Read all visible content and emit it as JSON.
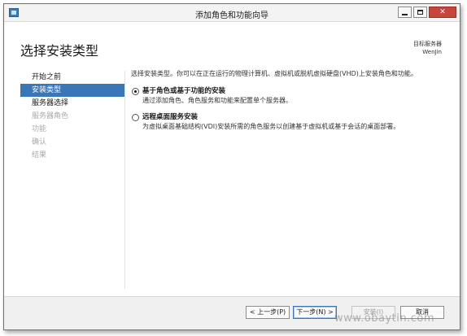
{
  "window": {
    "title": "添加角色和功能向导",
    "min_label": "",
    "max_label": "",
    "close_label": "✕"
  },
  "header": {
    "page_title": "选择安装类型",
    "destination_label": "目标服务器",
    "destination_server": "WenJin"
  },
  "nav": {
    "items": [
      {
        "label": "开始之前",
        "state": "normal"
      },
      {
        "label": "安装类型",
        "state": "selected"
      },
      {
        "label": "服务器选择",
        "state": "normal"
      },
      {
        "label": "服务器角色",
        "state": "disabled"
      },
      {
        "label": "功能",
        "state": "disabled"
      },
      {
        "label": "确认",
        "state": "disabled"
      },
      {
        "label": "结果",
        "state": "disabled"
      }
    ]
  },
  "content": {
    "intro": "选择安装类型。你可以在正在运行的物理计算机、虚拟机或脱机虚拟硬盘(VHD)上安装角色和功能。",
    "options": [
      {
        "title": "基于角色或基于功能的安装",
        "description": "通过添加角色、角色服务和功能来配置单个服务器。",
        "checked": true
      },
      {
        "title": "远程桌面服务安装",
        "description": "为虚拟桌面基础结构(VDI)安装所需的角色服务以创建基于虚拟机或基于会话的桌面部署。",
        "checked": false
      }
    ]
  },
  "footer": {
    "prev_label": "< 上一步(P)",
    "next_label": "下一步(N) >",
    "install_label": "安装(I)",
    "cancel_label": "取消"
  },
  "watermark": "www.obaytin.com",
  "colors": {
    "selected_nav": "#3b76b6",
    "close_button": "#c7453a"
  }
}
